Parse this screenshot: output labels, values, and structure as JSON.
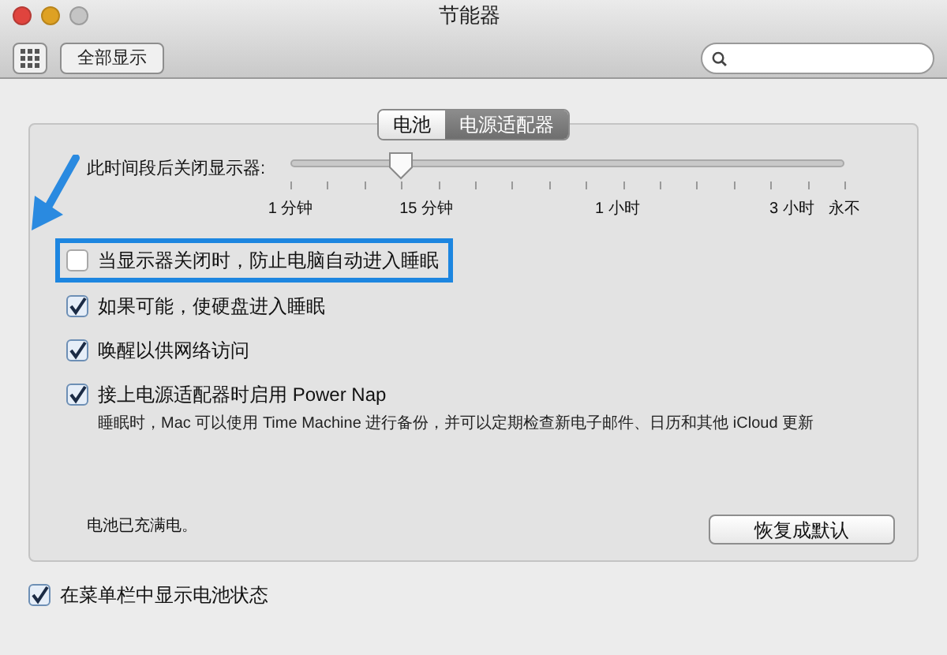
{
  "window": {
    "title": "节能器"
  },
  "toolbar": {
    "show_all": "全部显示",
    "search": {
      "kind": "search"
    }
  },
  "tabs": [
    {
      "label": "电池",
      "selected": false
    },
    {
      "label": "电源适配器",
      "selected": true
    }
  ],
  "display_sleep": {
    "label": "此时间段后关闭显示器:",
    "level": 0.2,
    "ticks": [
      "1 分钟",
      "15 分钟",
      "1 小时",
      "3 小时",
      "永不"
    ]
  },
  "options": [
    {
      "label": "当显示器关闭时，防止电脑自动进入睡眠",
      "checked": false,
      "highlighted": true
    },
    {
      "label": "如果可能，使硬盘进入睡眠",
      "checked": true,
      "highlighted": false
    },
    {
      "label": "唤醒以供网络访问",
      "checked": true,
      "highlighted": false
    },
    {
      "label": "接上电源适配器时启用 Power Nap",
      "checked": true,
      "highlighted": false,
      "note": "睡眠时，Mac 可以使用 Time Machine 进行备份，并可以定期检查新电子邮件、日历和其他 iCloud 更新"
    }
  ],
  "battery_status": "电池已充满电。",
  "restore_button": "恢复成默认",
  "menu_bar_option": {
    "label": "在菜单栏中显示电池状态",
    "checked": true
  }
}
